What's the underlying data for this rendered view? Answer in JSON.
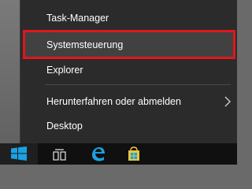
{
  "menu": {
    "items": [
      {
        "label": "Task-Manager"
      },
      {
        "label": "Systemsteuerung"
      },
      {
        "label": "Explorer"
      },
      {
        "label": "Herunterfahren oder abmelden"
      },
      {
        "label": "Desktop"
      }
    ],
    "highlighted_item": "Systemsteuerung",
    "highlight_color": "#e0161c"
  },
  "taskbar": {
    "icons": [
      "windows-logo-icon",
      "task-view-icon",
      "edge-browser-icon",
      "store-icon"
    ]
  },
  "colors": {
    "menu_background": "#2b2b2b",
    "menu_text": "#ffffff",
    "taskbar_background": "#101010",
    "accent_blue": "#1ba1e2"
  }
}
